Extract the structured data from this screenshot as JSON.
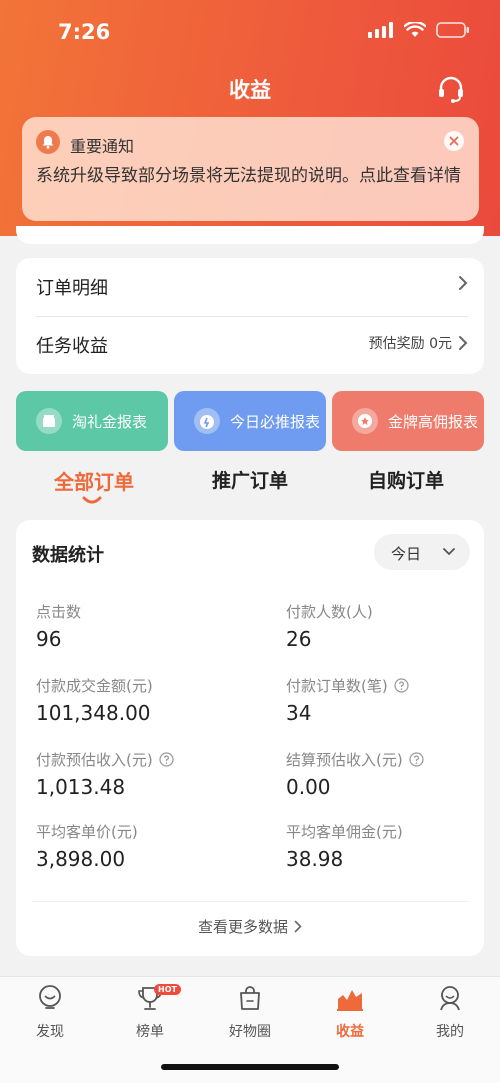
{
  "status_bar": {
    "time": "7:26"
  },
  "header": {
    "title": "收益"
  },
  "notice": {
    "title": "重要通知",
    "text": "系统升级导致部分场景将无法提现的说明。点此查看详情"
  },
  "menu": {
    "order_detail": "订单明细",
    "task_income": "任务收益",
    "task_reward": "预估奖励 0元"
  },
  "reports": [
    {
      "label": "淘礼金报表",
      "color": "#5cc8a6"
    },
    {
      "label": "今日必推报表",
      "color": "#6f9cf0"
    },
    {
      "label": "金牌高佣报表",
      "color": "#ee7b6b"
    }
  ],
  "order_tabs": [
    {
      "label": "全部订单",
      "active": true
    },
    {
      "label": "推广订单",
      "active": false
    },
    {
      "label": "自购订单",
      "active": false
    }
  ],
  "stats": {
    "title": "数据统计",
    "date_filter": "今日",
    "metrics": [
      {
        "label": "点击数",
        "value": "96"
      },
      {
        "label": "付款人数(人)",
        "value": "26"
      },
      {
        "label": "付款成交金额(元)",
        "value": "101,348.00"
      },
      {
        "label": "付款订单数(笔)",
        "value": "34"
      },
      {
        "label": "付款预估收入(元)",
        "value": "1,013.48"
      },
      {
        "label": "结算预估收入(元)",
        "value": "0.00"
      },
      {
        "label": "平均客单价(元)",
        "value": "3,898.00"
      },
      {
        "label": "平均客单佣金(元)",
        "value": "38.98"
      }
    ],
    "more": "查看更多数据"
  },
  "tabbar": {
    "items": [
      {
        "label": "发现",
        "icon": "discover-icon"
      },
      {
        "label": "榜单",
        "icon": "trophy-icon",
        "badge": "HOT"
      },
      {
        "label": "好物圈",
        "icon": "bag-icon"
      },
      {
        "label": "收益",
        "icon": "income-chart-icon",
        "active": true
      },
      {
        "label": "我的",
        "icon": "profile-icon"
      }
    ]
  },
  "colors": {
    "accent": "#ee6a3b",
    "header_start": "#f27438",
    "header_end": "#ea4a3c"
  }
}
